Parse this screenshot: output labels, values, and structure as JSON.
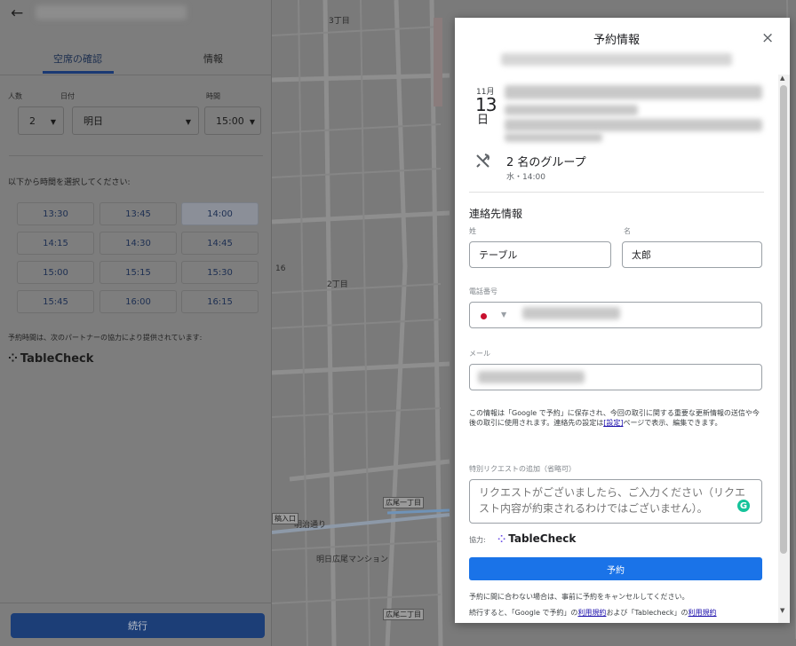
{
  "left_panel": {
    "tabs": [
      "空席の確認",
      "情報"
    ],
    "labels": {
      "party_size": "人数",
      "date": "日付",
      "time": "時間"
    },
    "selects": {
      "party_size": "2",
      "date": "明日",
      "time": "15:00"
    },
    "select_prompt": "以下から時間を選択してください:",
    "time_slots": [
      "13:30",
      "13:45",
      "14:00",
      "14:15",
      "14:30",
      "14:45",
      "15:00",
      "15:15",
      "15:30",
      "15:45",
      "16:00",
      "16:15"
    ],
    "selected_slot": "14:00",
    "partner_note": "予約時間は、次のパートナーの協力により提供されています:",
    "partner_name": "TableCheck",
    "continue_label": "続行"
  },
  "map": {
    "labels": [
      "3丁目",
      "2丁目",
      "16",
      "明治通り",
      "明日広尾マンション",
      "広尾一丁目",
      "広尾二丁目",
      "稿入口"
    ]
  },
  "dialog": {
    "title": "予約情報",
    "close": "×",
    "date": {
      "month": "11月",
      "day": "13",
      "suffix": "日"
    },
    "group": {
      "title": "2 名のグループ",
      "time": "水・14:00"
    },
    "contact_heading": "連絡先情報",
    "last_name": {
      "label": "姓",
      "value": "テーブル"
    },
    "first_name": {
      "label": "名",
      "value": "太郎"
    },
    "phone_label": "電話番号",
    "email_label": "メール",
    "privacy_note": {
      "before": "この情報は「Google で予約」に保存され、今回の取引に関する重要な更新情報の送信や今後の取引に使用されます。連絡先の設定は",
      "link": "[設定]",
      "after": "ページで表示、編集できます。"
    },
    "request_label": "特別リクエストの追加（省略可）",
    "request_placeholder": "リクエストがございましたら、ご入力ください（リクエスト内容が約束されるわけではございません）。",
    "powered_by": "協力:",
    "partner_name": "TableCheck",
    "reserve_label": "予約",
    "cancel_note": "予約に間に合わない場合は、事前に予約をキャンセルしてください。",
    "terms": {
      "before": "続行すると、「Google で予約」の",
      "link1": "利用規約",
      "middle": "および「Tablecheck」の",
      "link2": "利用規約"
    }
  }
}
